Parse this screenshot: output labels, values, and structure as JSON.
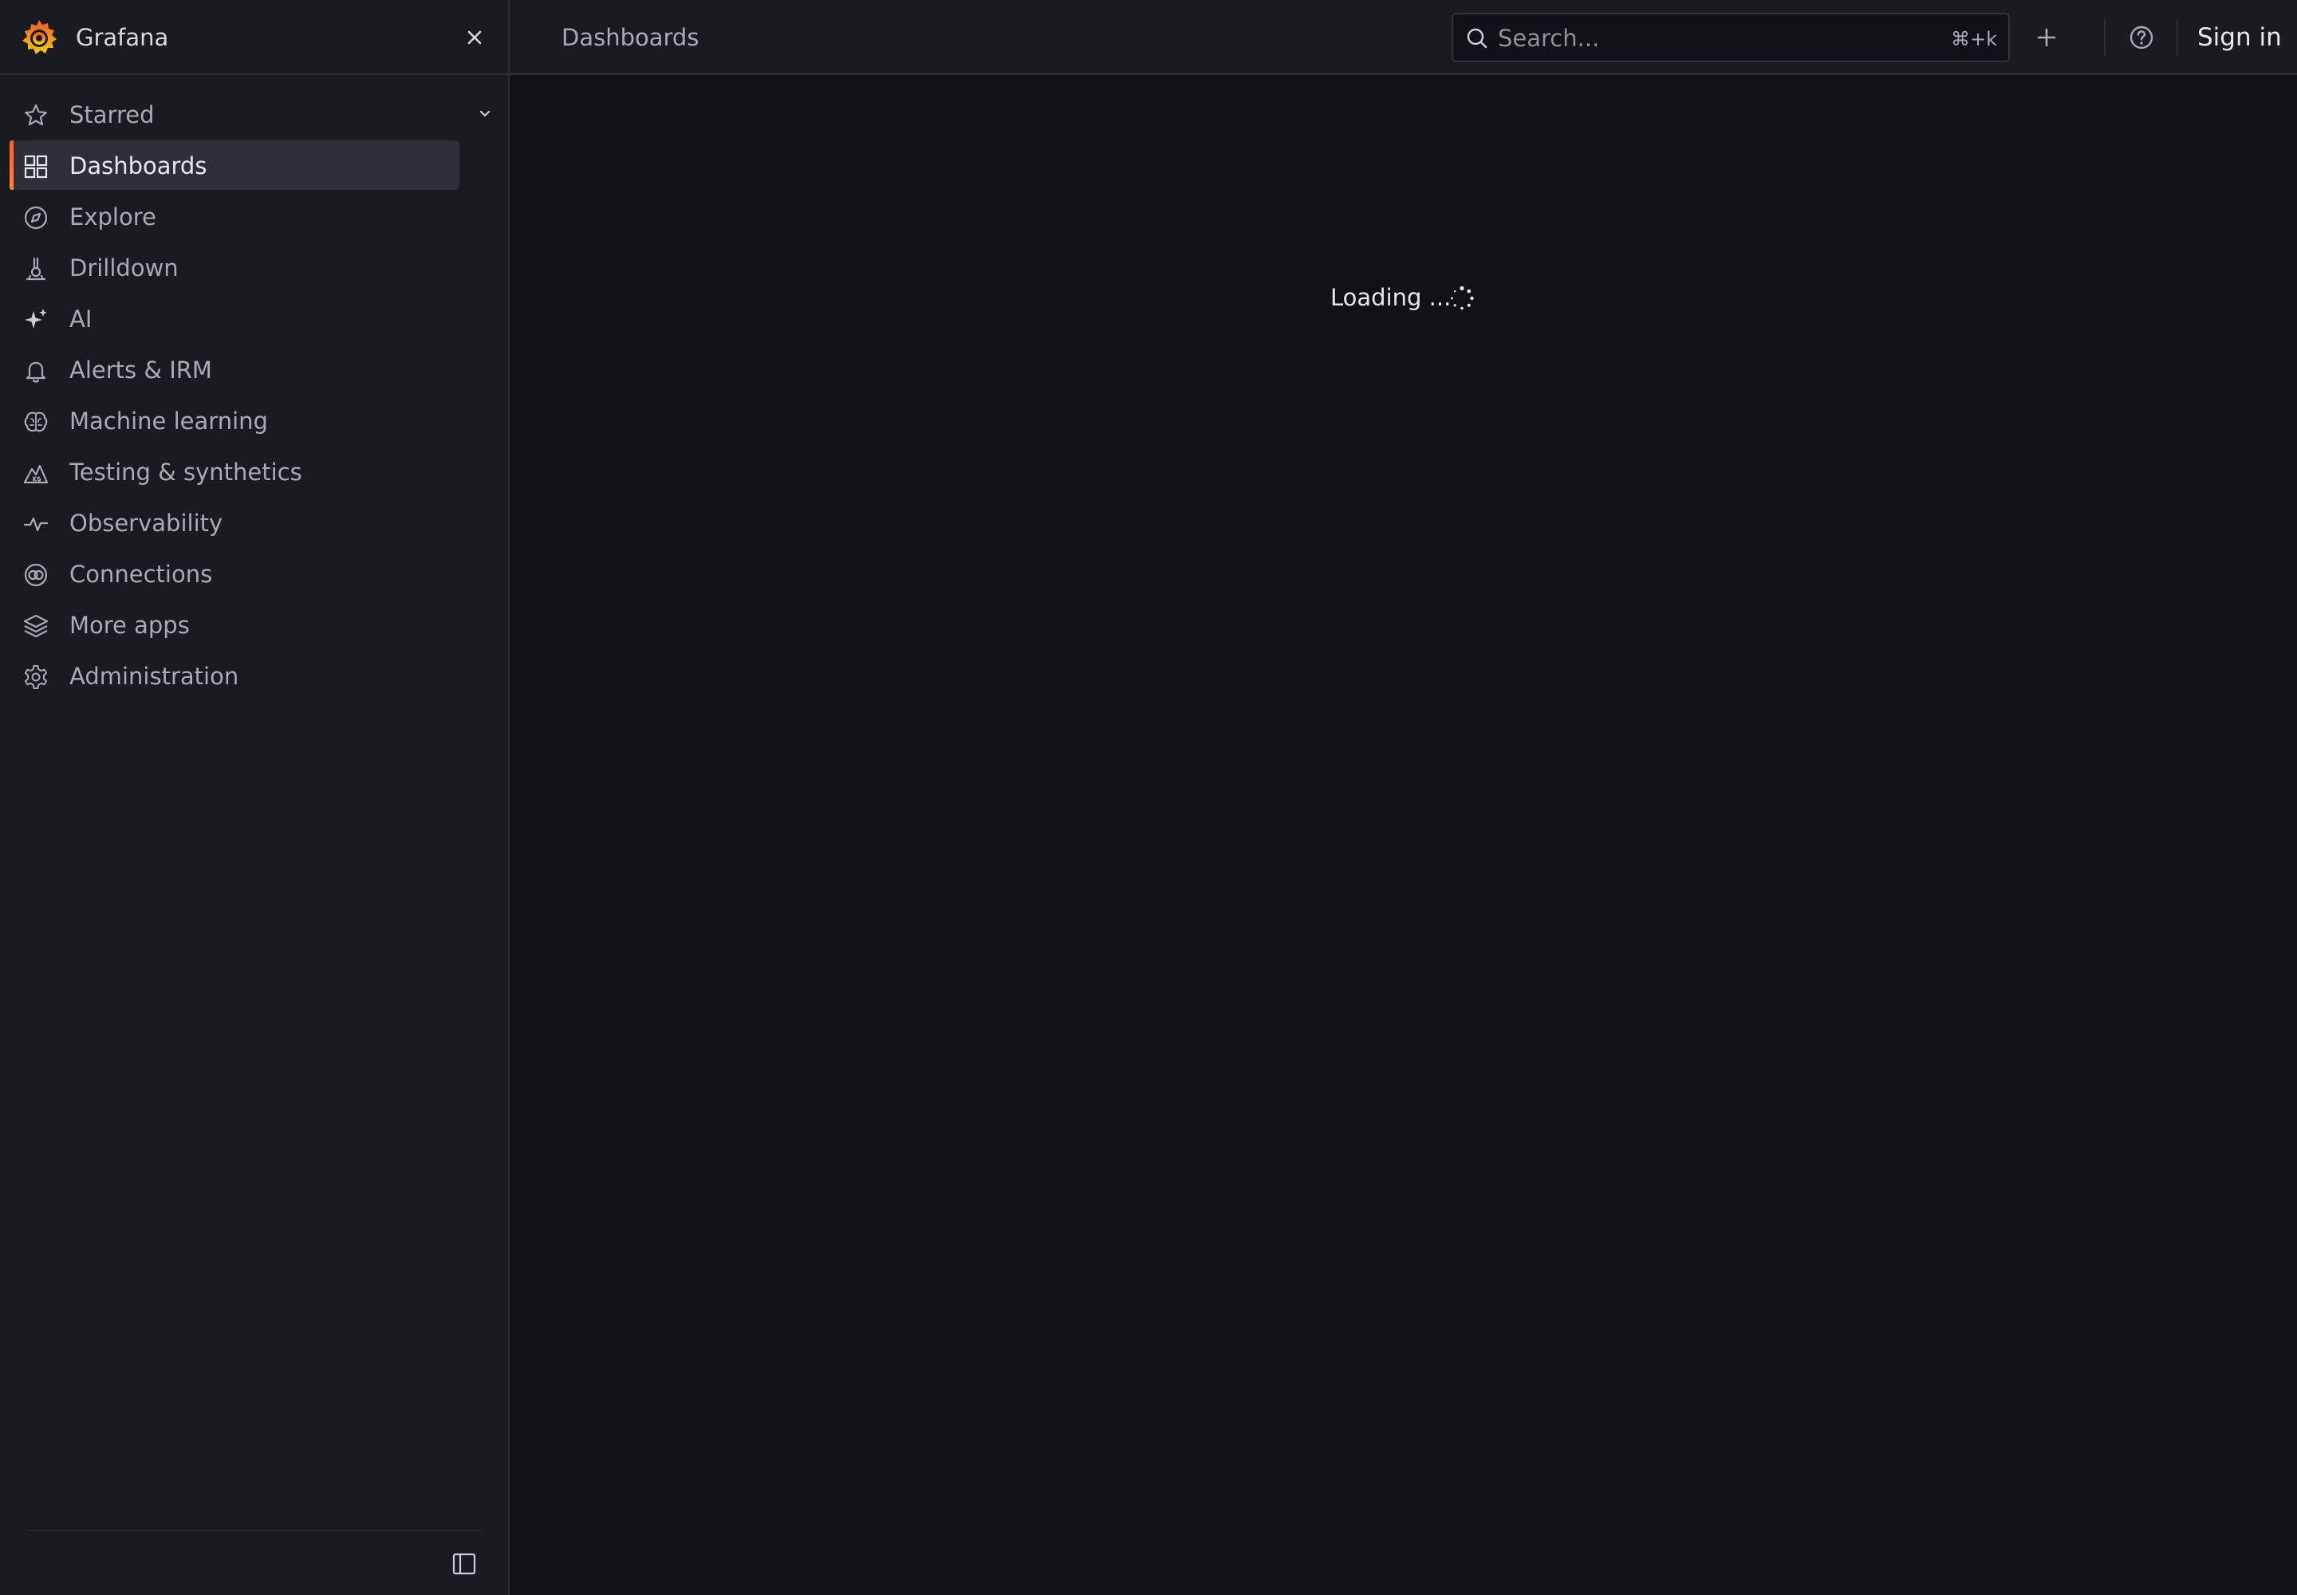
{
  "app": {
    "name": "Grafana",
    "accent": "#f46800"
  },
  "sidebar": {
    "items": [
      {
        "label": "Starred",
        "icon": "star-icon"
      },
      {
        "label": "Dashboards",
        "icon": "apps-icon",
        "active": true
      },
      {
        "label": "Explore",
        "icon": "compass-icon"
      },
      {
        "label": "Drilldown",
        "icon": "drilldown-icon"
      },
      {
        "label": "AI",
        "icon": "sparkle-icon"
      },
      {
        "label": "Alerts & IRM",
        "icon": "bell-icon"
      },
      {
        "label": "Machine learning",
        "icon": "brain-icon"
      },
      {
        "label": "Testing & synthetics",
        "icon": "k6-icon"
      },
      {
        "label": "Observability",
        "icon": "heartbeat-icon"
      },
      {
        "label": "Connections",
        "icon": "connections-icon"
      },
      {
        "label": "More apps",
        "icon": "layers-icon"
      },
      {
        "label": "Administration",
        "icon": "cog-icon"
      }
    ]
  },
  "topbar": {
    "breadcrumb": "Dashboards",
    "search": {
      "placeholder": "Search...",
      "shortcut": "⌘+k"
    },
    "sign_in": "Sign in"
  },
  "main": {
    "loading": "Loading ..."
  }
}
